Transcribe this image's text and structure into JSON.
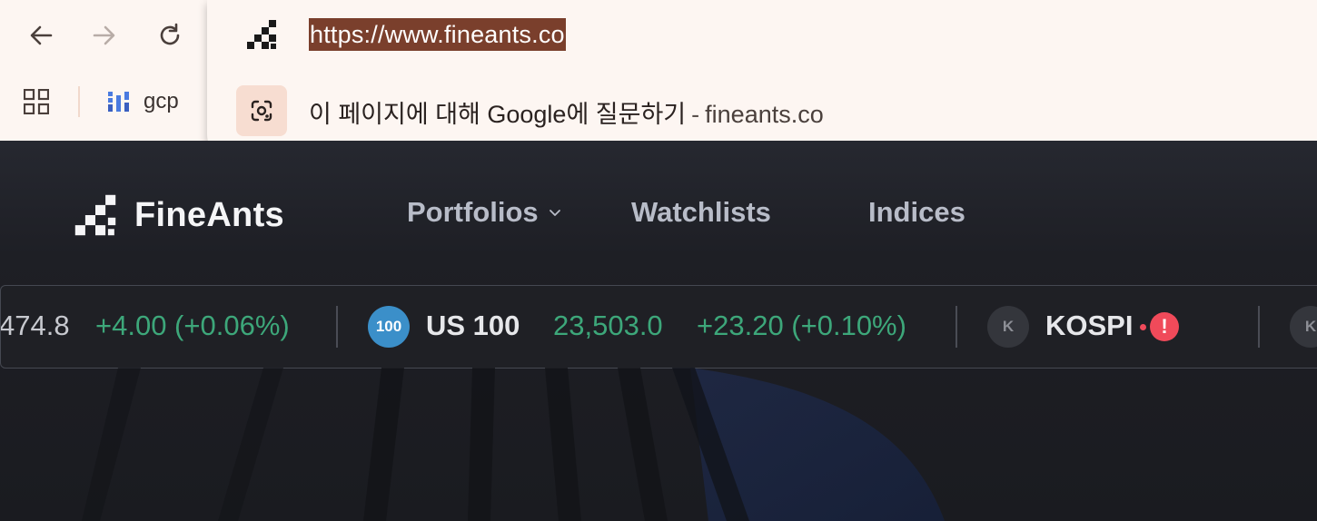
{
  "browser": {
    "bookmarks": [
      {
        "label": "gcp"
      }
    ],
    "omnibox": {
      "url": "https://www.fineants.co",
      "suggestion": {
        "text": "이 페이지에 대해 Google에 질문하기",
        "separator": "-",
        "site": "fineants.co"
      }
    }
  },
  "site": {
    "logo_text": "FineAnts",
    "nav": [
      {
        "label": "Portfolios",
        "has_dropdown": true
      },
      {
        "label": "Watchlists"
      },
      {
        "label": "Indices"
      }
    ]
  },
  "ticker": {
    "items": [
      {
        "value": "474.8",
        "change": "+4.00 (+0.06%)"
      },
      {
        "badge": "100",
        "name": "US 100",
        "value": "23,503.0",
        "change": "+23.20 (+0.10%)"
      },
      {
        "badge": "K",
        "name": "KOSPI",
        "alert_icon": "!"
      },
      {
        "badge": "K"
      }
    ]
  },
  "colors": {
    "positive": "#3da77a",
    "alert": "#f04a5a",
    "url_highlight": "#7a3f2c"
  }
}
